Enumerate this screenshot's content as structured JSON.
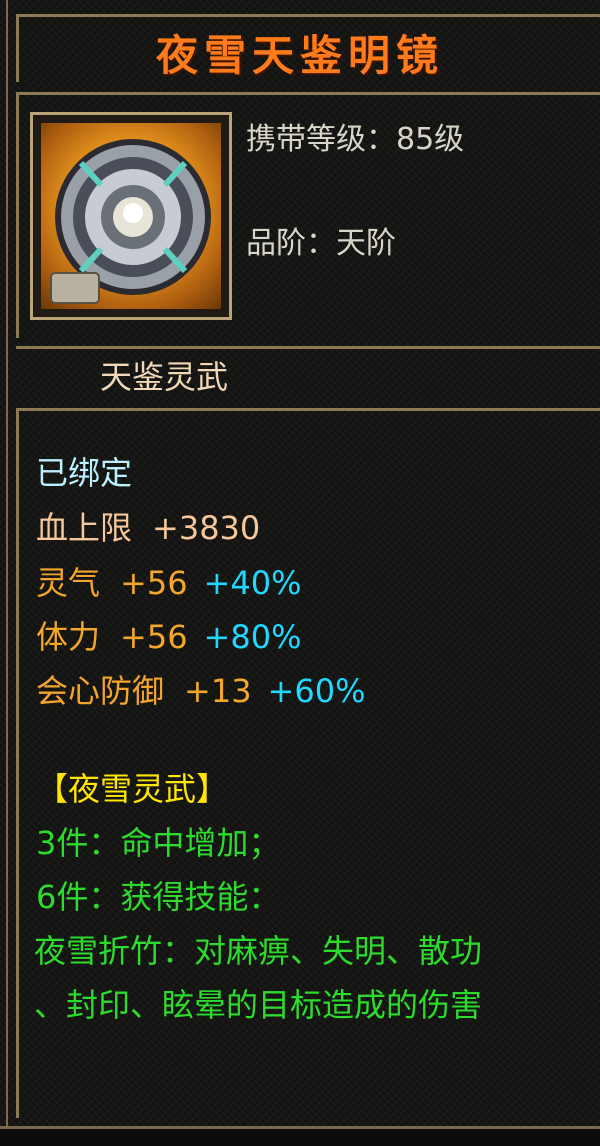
{
  "item": {
    "name": "夜雪天鉴明镜",
    "carry_level_label": "携带等级：85级",
    "quality_label": "品阶：天阶",
    "category": "天鉴灵武"
  },
  "icon": {
    "name": "mirror-shield-icon"
  },
  "stats": {
    "bound": "已绑定",
    "hp": {
      "label": "血上限",
      "value": "+3830"
    },
    "lingqi": {
      "label": "灵气",
      "value": "+56",
      "pct": "+40%"
    },
    "tili": {
      "label": "体力",
      "value": "+56",
      "pct": "+80%"
    },
    "crit_def": {
      "label": "会心防御",
      "value": "+13",
      "pct": "+60%"
    }
  },
  "set": {
    "title": "【夜雪灵武】",
    "bonus3": "3件：命中增加；",
    "bonus6": "6件：获得技能：",
    "skill_line1": "夜雪折竹：对麻痹、失明、散功",
    "skill_line2": "、封印、眩晕的目标造成的伤害"
  },
  "colors": {
    "title": "#ff7a1a",
    "bound": "#bdf0ff",
    "attr": "#f4a62a",
    "pct": "#20d8ff",
    "set_title": "#ffe600",
    "set_text": "#2ddb2d"
  }
}
